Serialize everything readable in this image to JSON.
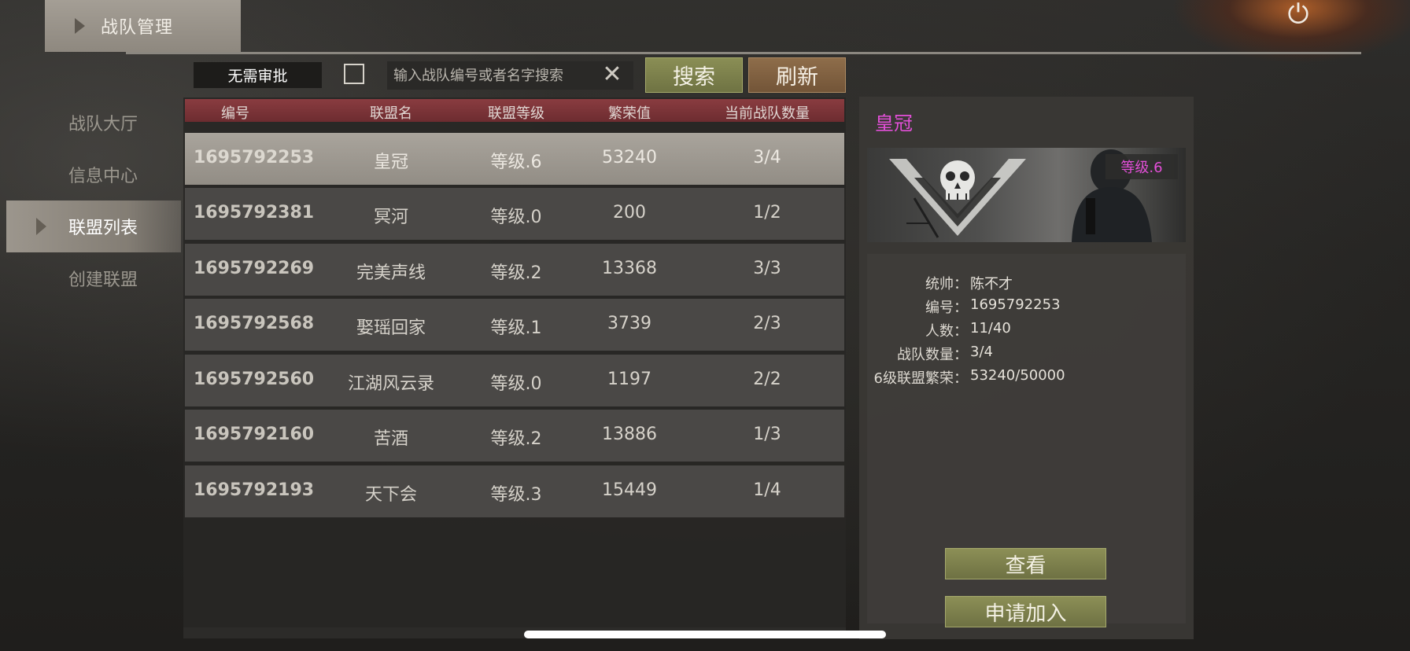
{
  "header": {
    "tab_label": "战队管理",
    "power_icon": "power-icon"
  },
  "nav": {
    "items": [
      {
        "label": "战队大厅",
        "active": false
      },
      {
        "label": "信息中心",
        "active": false
      },
      {
        "label": "联盟列表",
        "active": true
      },
      {
        "label": "创建联盟",
        "active": false
      }
    ]
  },
  "filter": {
    "no_approval_label": "无需审批",
    "checkbox_checked": false,
    "search_placeholder": "输入战队编号或者名字搜索",
    "search_value": "",
    "search_button": "搜索",
    "refresh_button": "刷新"
  },
  "table": {
    "columns": [
      "编号",
      "联盟名",
      "联盟等级",
      "繁荣值",
      "当前战队数量"
    ],
    "rows": [
      {
        "id": "1695792253",
        "name": "皇冠",
        "level": "等级.6",
        "prosperity": "53240",
        "teams": "3/4",
        "selected": true
      },
      {
        "id": "1695792381",
        "name": "冥河",
        "level": "等级.0",
        "prosperity": "200",
        "teams": "1/2",
        "selected": false
      },
      {
        "id": "1695792269",
        "name": "完美声线",
        "level": "等级.2",
        "prosperity": "13368",
        "teams": "3/3",
        "selected": false
      },
      {
        "id": "1695792568",
        "name": "娶瑶回家",
        "level": "等级.1",
        "prosperity": "3739",
        "teams": "2/3",
        "selected": false
      },
      {
        "id": "1695792560",
        "name": "江湖风云录",
        "level": "等级.0",
        "prosperity": "1197",
        "teams": "2/2",
        "selected": false
      },
      {
        "id": "1695792160",
        "name": "苦酒",
        "level": "等级.2",
        "prosperity": "13886",
        "teams": "1/3",
        "selected": false
      },
      {
        "id": "1695792193",
        "name": "天下会",
        "level": "等级.3",
        "prosperity": "15449",
        "teams": "1/4",
        "selected": false
      }
    ]
  },
  "detail": {
    "title": "皇冠",
    "level_badge": "等级.6",
    "info": [
      {
        "key": "统帅：",
        "value": "陈不才"
      },
      {
        "key": "编号：",
        "value": "1695792253"
      },
      {
        "key": "人数：",
        "value": "11/40"
      },
      {
        "key": "战队数量：",
        "value": "3/4"
      },
      {
        "key": "6级联盟繁荣：",
        "value": "53240/50000"
      }
    ],
    "view_button": "查看",
    "join_button": "申请加入"
  },
  "colors": {
    "accent_magenta": "#e34fd8",
    "header_red": "#7d3438",
    "button_olive": "#7d8049",
    "button_brown": "#80603f"
  }
}
